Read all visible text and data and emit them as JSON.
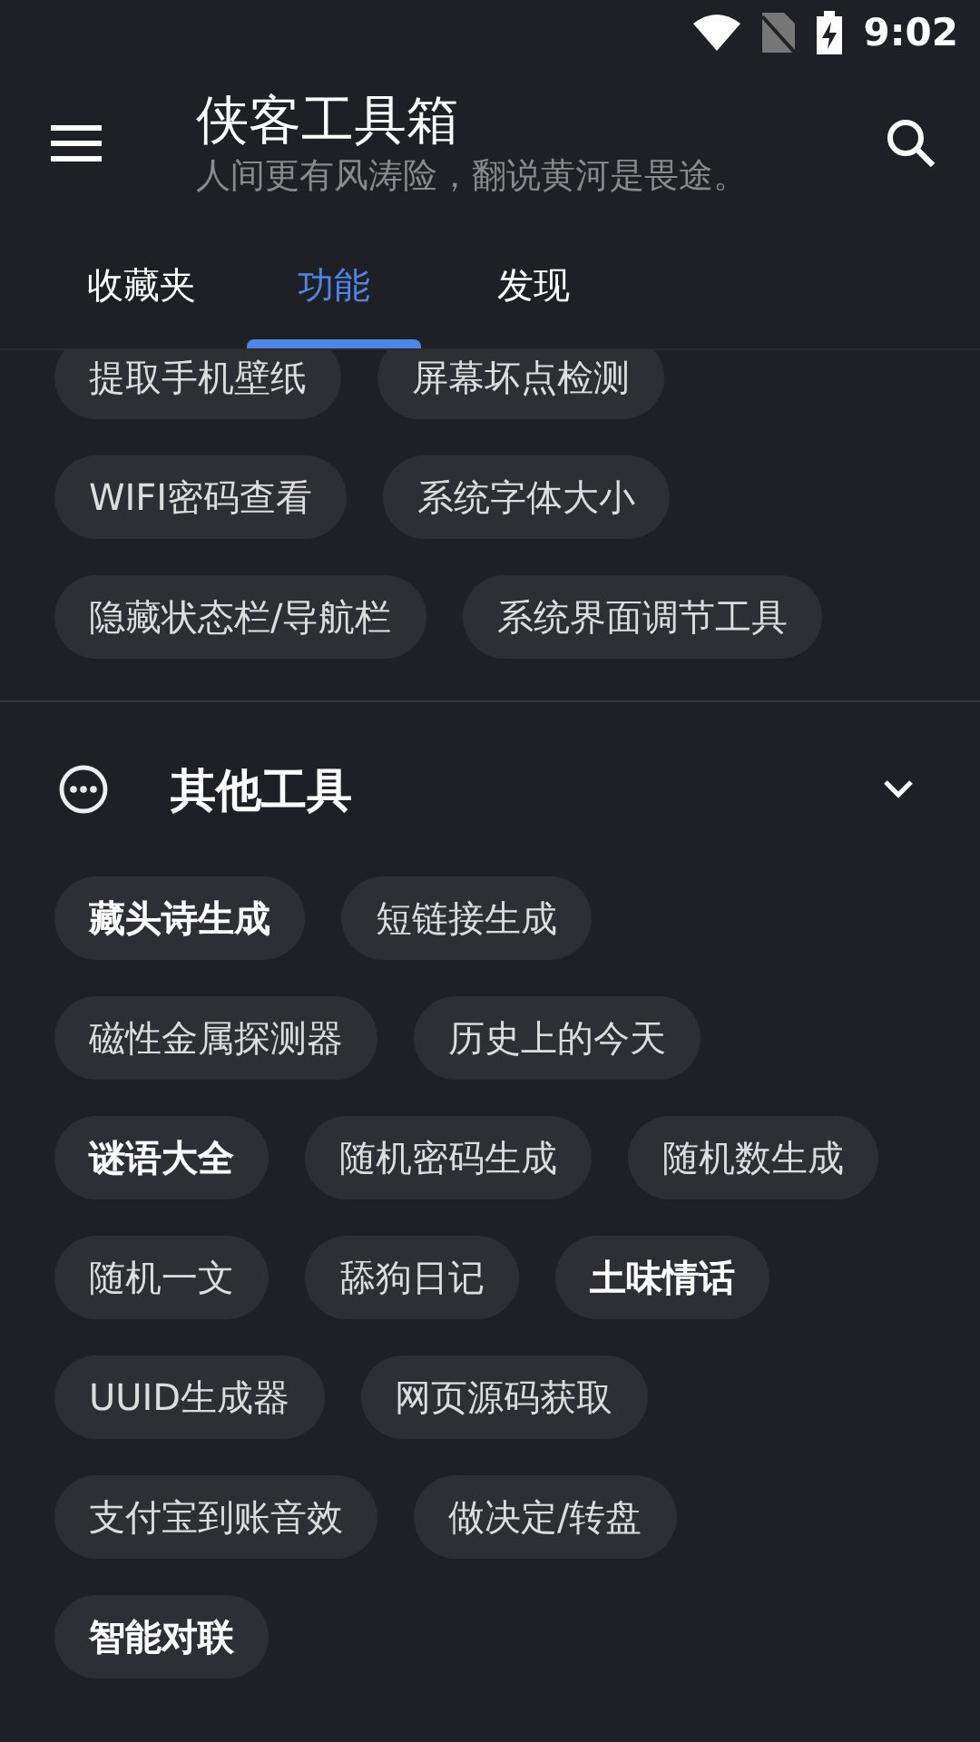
{
  "status_bar": {
    "time": "9:02"
  },
  "app_bar": {
    "title": "侠客工具箱",
    "subtitle": "人间更有风涛险，翻说黄河是畏途。"
  },
  "tabs": [
    {
      "label": "收藏夹",
      "selected": false
    },
    {
      "label": "功能",
      "selected": true
    },
    {
      "label": "发现",
      "selected": false
    }
  ],
  "upper_section": {
    "chips": [
      {
        "label": "提取手机壁纸",
        "featured": false
      },
      {
        "label": "屏幕坏点检测",
        "featured": false
      },
      {
        "label": "WIFI密码查看",
        "featured": false
      },
      {
        "label": "系统字体大小",
        "featured": false
      },
      {
        "label": "隐藏状态栏/导航栏",
        "featured": false
      },
      {
        "label": "系统界面调节工具",
        "featured": false
      }
    ]
  },
  "section": {
    "title": "其他工具",
    "expanded": true,
    "chips": [
      {
        "label": "藏头诗生成",
        "featured": true
      },
      {
        "label": "短链接生成",
        "featured": false
      },
      {
        "label": "磁性金属探测器",
        "featured": false
      },
      {
        "label": "历史上的今天",
        "featured": false
      },
      {
        "label": "谜语大全",
        "featured": true
      },
      {
        "label": "随机密码生成",
        "featured": false
      },
      {
        "label": "随机数生成",
        "featured": false
      },
      {
        "label": "随机一文",
        "featured": false
      },
      {
        "label": "舔狗日记",
        "featured": false
      },
      {
        "label": "土味情话",
        "featured": true
      },
      {
        "label": "UUID生成器",
        "featured": false
      },
      {
        "label": "网页源码获取",
        "featured": false
      },
      {
        "label": "支付宝到账音效",
        "featured": false
      },
      {
        "label": "做决定/转盘",
        "featured": false
      },
      {
        "label": "智能对联",
        "featured": true
      }
    ]
  }
}
